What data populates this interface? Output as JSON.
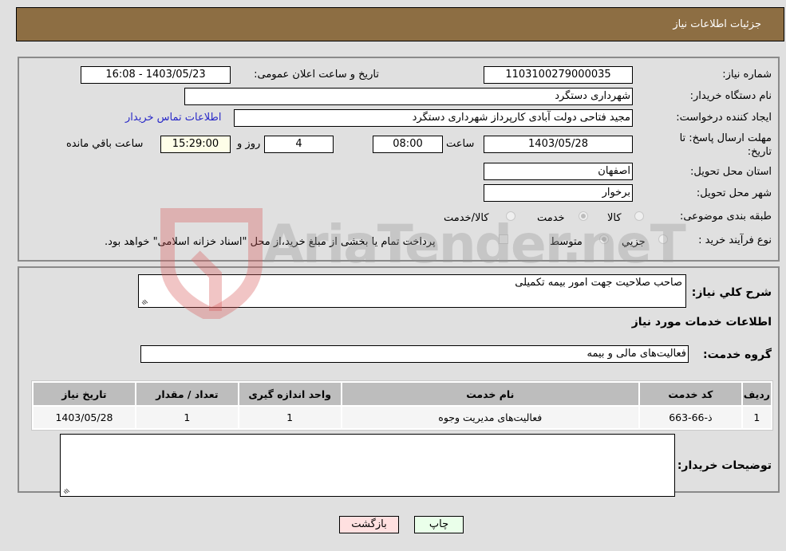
{
  "header": {
    "title": "جزئیات اطلاعات نیاز"
  },
  "details": {
    "need_number": {
      "label": "شماره نیاز:",
      "value": "1103100279000035"
    },
    "announce_datetime": {
      "label": "تاریخ و ساعت اعلان عمومی:",
      "value": "1403/05/23 - 16:08"
    },
    "buyer_org": {
      "label": "نام دستگاه خریدار:",
      "value": "شهرداری دستگرد"
    },
    "requester": {
      "label": "ایجاد کننده درخواست:",
      "value": "مجید فتاحی دولت آبادی کارپرداز شهرداری دستگرد"
    },
    "buyer_contact_link": "اطلاعات تماس خریدار",
    "deadline": {
      "label_line1": "مهلت ارسال پاسخ: تا",
      "label_line2": "تاریخ:",
      "date": "1403/05/28",
      "time_label": "ساعت",
      "time": "08:00",
      "days": "4",
      "days_label": "روز و",
      "remaining_time": "15:29:00",
      "remaining_label": "ساعت باقي مانده"
    },
    "province": {
      "label": "استان محل تحویل:",
      "value": "اصفهان"
    },
    "city": {
      "label": "شهر محل تحویل:",
      "value": "برخوار"
    },
    "category": {
      "label": "طبقه بندی موضوعی:",
      "options": [
        "کالا",
        "خدمت",
        "کالا/خدمت"
      ],
      "selected": "خدمت"
    },
    "purchase_type": {
      "label": "نوع فرآیند خرید :",
      "options": [
        "جزیي",
        "متوسط"
      ],
      "selected": "متوسط",
      "treasury_note": "پرداخت تمام یا بخشی از مبلغ خرید،از محل \"اسناد خزانه اسلامی\" خواهد بود."
    }
  },
  "description": {
    "label": "شرح کلي نیاز:",
    "value": "صاحب صلاحیت جهت امور بیمه تکمیلی"
  },
  "services": {
    "section_title": "اطلاعات خدمات مورد نیاز",
    "group_label": "گروه خدمت:",
    "group_value": "فعالیت‌های مالی و بیمه",
    "table": {
      "headers": [
        "ردیف",
        "کد خدمت",
        "نام خدمت",
        "واحد اندازه گیری",
        "تعداد / مقدار",
        "تاریخ نیاز"
      ],
      "rows": [
        [
          "1",
          "ذ-66-663",
          "فعالیت‌های مدیریت وجوه",
          "1",
          "1",
          "1403/05/28"
        ]
      ]
    }
  },
  "buyer_notes": {
    "label": "توضیحات خریدار:",
    "value": ""
  },
  "buttons": {
    "print": "چاپ",
    "back": "بازگشت"
  },
  "watermark": {
    "text": "AriaTender.neT"
  }
}
